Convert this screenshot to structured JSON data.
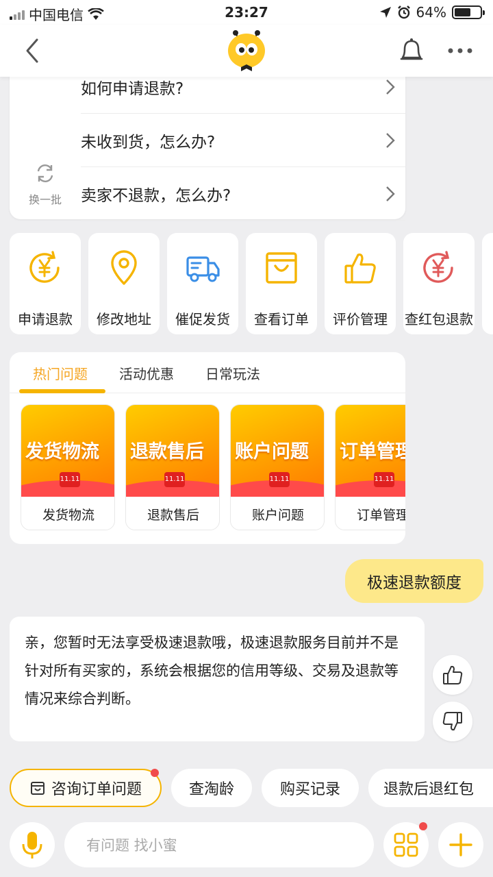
{
  "status_bar": {
    "carrier": "中国电信",
    "time": "23:27",
    "battery": "64%"
  },
  "faq": {
    "items": [
      {
        "label": "如何申请退款?"
      },
      {
        "label": "未收到货，怎么办?"
      },
      {
        "label": "卖家不退款，怎么办?"
      }
    ],
    "refresh_label": "换一批"
  },
  "quick_actions": [
    {
      "label": "申请退款",
      "icon": "yuan-refund-icon",
      "color": "#f5b400"
    },
    {
      "label": "修改地址",
      "icon": "location-pin-icon",
      "color": "#f5b400"
    },
    {
      "label": "催促发货",
      "icon": "delivery-truck-icon",
      "color": "#3a8ee6"
    },
    {
      "label": "查看订单",
      "icon": "shopping-bag-icon",
      "color": "#f5b400"
    },
    {
      "label": "评价管理",
      "icon": "thumbs-up-icon",
      "color": "#f5b400"
    },
    {
      "label": "查红包退款",
      "icon": "yuan-refund-icon",
      "color": "#e05a5a"
    }
  ],
  "topics": {
    "tabs": [
      {
        "label": "热门问题",
        "active": true
      },
      {
        "label": "活动优惠",
        "active": false
      },
      {
        "label": "日常玩法",
        "active": false
      }
    ],
    "cards": [
      {
        "banner": "发货物流",
        "caption": "发货物流",
        "badge": "11.11"
      },
      {
        "banner": "退款售后",
        "caption": "退款售后",
        "badge": "11.11"
      },
      {
        "banner": "账户问题",
        "caption": "账户问题",
        "badge": "11.11"
      },
      {
        "banner": "订单管理",
        "caption": "订单管理",
        "badge": "11.11"
      }
    ]
  },
  "chat": {
    "user_message": "极速退款额度",
    "bot_message": "亲，您暂时无法享受极速退款哦，极速退款服务目前并不是针对所有买家的，系统会根据您的信用等级、交易及退款等情况来综合判断。"
  },
  "chips": [
    {
      "label": "咨询订单问题"
    },
    {
      "label": "查淘龄"
    },
    {
      "label": "购买记录"
    },
    {
      "label": "退款后退红包"
    }
  ],
  "input": {
    "placeholder": "有问题 找小蜜"
  },
  "colors": {
    "accent": "#f5b400",
    "user_bubble": "#fde88a",
    "notification_dot": "#f04b4b"
  }
}
